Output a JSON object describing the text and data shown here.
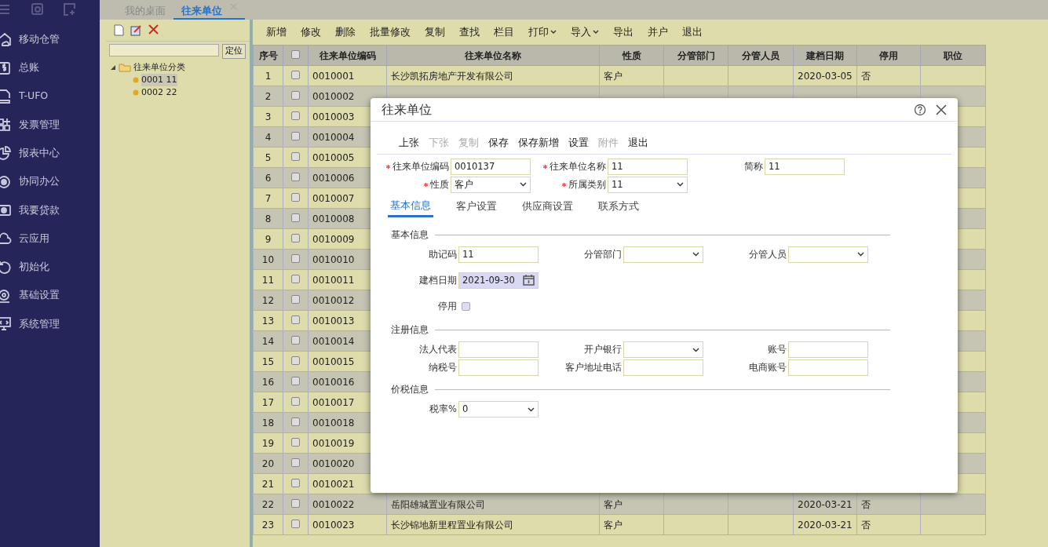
{
  "sidebar": {
    "items": [
      {
        "label": "移动仓管"
      },
      {
        "label": "总账"
      },
      {
        "label": "T-UFO"
      },
      {
        "label": "发票管理"
      },
      {
        "label": "报表中心"
      },
      {
        "label": "协同办公"
      },
      {
        "label": "我要贷款"
      },
      {
        "label": "云应用"
      },
      {
        "label": "初始化"
      },
      {
        "label": "基础设置"
      },
      {
        "label": "系统管理"
      }
    ]
  },
  "tabs": [
    {
      "label": "我的桌面",
      "selected": false,
      "closable": false
    },
    {
      "label": "往来单位",
      "selected": true,
      "closable": true
    }
  ],
  "tree_panel": {
    "search_button": "定位",
    "tree": [
      {
        "label": "往来单位分类",
        "expanded": true,
        "selected": false,
        "children": [
          {
            "label": "0001 11",
            "selected": true
          },
          {
            "label": "0002 22",
            "selected": false
          }
        ]
      }
    ]
  },
  "toolbar": [
    {
      "label": "新增",
      "dropdown": false
    },
    {
      "label": "修改",
      "dropdown": false
    },
    {
      "label": "删除",
      "dropdown": false
    },
    {
      "label": "批量修改",
      "dropdown": false
    },
    {
      "label": "复制",
      "dropdown": false
    },
    {
      "label": "查找",
      "dropdown": false
    },
    {
      "label": "栏目",
      "dropdown": false
    },
    {
      "label": "打印",
      "dropdown": true
    },
    {
      "label": "导入",
      "dropdown": true
    },
    {
      "label": "导出",
      "dropdown": false
    },
    {
      "label": "并户",
      "dropdown": false
    },
    {
      "label": "退出",
      "dropdown": false
    }
  ],
  "table": {
    "columns": [
      "序号",
      "",
      "往来单位编码",
      "往来单位名称",
      "性质",
      "分管部门",
      "分管人员",
      "建档日期",
      "停用",
      "职位"
    ],
    "header_checked": false,
    "rows": [
      {
        "seq": "1",
        "checked": false,
        "code": "0010001",
        "name": "长沙凯拓房地产开发有限公司",
        "nature": "客户",
        "date": "2020-03-05",
        "disabled": "否"
      },
      {
        "seq": "2",
        "checked": false,
        "code": "0010002"
      },
      {
        "seq": "3",
        "checked": false,
        "code": "0010003"
      },
      {
        "seq": "4",
        "checked": false,
        "code": "0010004"
      },
      {
        "seq": "5",
        "checked": false,
        "code": "0010005"
      },
      {
        "seq": "6",
        "checked": false,
        "code": "0010006"
      },
      {
        "seq": "7",
        "checked": false,
        "code": "0010007"
      },
      {
        "seq": "8",
        "checked": false,
        "code": "0010008"
      },
      {
        "seq": "9",
        "checked": false,
        "code": "0010009"
      },
      {
        "seq": "10",
        "checked": false,
        "code": "0010010"
      },
      {
        "seq": "11",
        "checked": false,
        "code": "0010011"
      },
      {
        "seq": "12",
        "checked": false,
        "code": "0010012"
      },
      {
        "seq": "13",
        "checked": false,
        "code": "0010013"
      },
      {
        "seq": "14",
        "checked": false,
        "code": "0010014"
      },
      {
        "seq": "15",
        "checked": false,
        "code": "0010015"
      },
      {
        "seq": "16",
        "checked": false,
        "code": "0010016"
      },
      {
        "seq": "17",
        "checked": false,
        "code": "0010017"
      },
      {
        "seq": "18",
        "checked": false,
        "code": "0010018"
      },
      {
        "seq": "19",
        "checked": false,
        "code": "0010019"
      },
      {
        "seq": "20",
        "checked": false,
        "code": "0010020"
      },
      {
        "seq": "21",
        "checked": false,
        "code": "0010021"
      },
      {
        "seq": "22",
        "checked": false,
        "code": "0010022",
        "name": "岳阳雄城置业有限公司",
        "nature": "客户",
        "date": "2020-03-21",
        "disabled": "否"
      },
      {
        "seq": "23",
        "checked": false,
        "code": "0010023",
        "name": "长沙锦地新里程置业有限公司",
        "nature": "客户",
        "date": "2020-03-21",
        "disabled": "否"
      }
    ]
  },
  "dialog": {
    "title": "往来单位",
    "toolbar": [
      {
        "label": "上张",
        "disabled": false
      },
      {
        "label": "下张",
        "disabled": true
      },
      {
        "label": "复制",
        "disabled": true
      },
      {
        "label": "保存",
        "disabled": false
      },
      {
        "label": "保存新增",
        "disabled": false
      },
      {
        "label": "设置",
        "disabled": false
      },
      {
        "label": "附件",
        "disabled": true
      },
      {
        "label": "退出",
        "disabled": false
      }
    ],
    "header_rows": [
      [
        {
          "label": "往来单位编码",
          "required": true,
          "kind": "text",
          "value": "0010137"
        },
        {
          "label": "往来单位名称",
          "required": true,
          "kind": "text",
          "value": "11"
        },
        {
          "label": "简称",
          "required": false,
          "kind": "text",
          "value": "11"
        }
      ],
      [
        {
          "label": "性质",
          "required": true,
          "kind": "select",
          "value": "客户"
        },
        {
          "label": "所属类别",
          "required": true,
          "kind": "select",
          "value": "11"
        }
      ]
    ],
    "tabs": [
      {
        "label": "基本信息",
        "selected": true
      },
      {
        "label": "客户设置",
        "selected": false
      },
      {
        "label": "供应商设置",
        "selected": false
      },
      {
        "label": "联系方式",
        "selected": false
      }
    ],
    "sections": [
      {
        "title": "基本信息",
        "rows": [
          [
            {
              "label": "助记码",
              "kind": "text",
              "value": "11"
            },
            {
              "label": "分管部门",
              "kind": "select"
            },
            {
              "label": "分管人员",
              "kind": "select"
            }
          ],
          [
            {
              "label": "建档日期",
              "kind": "date",
              "value": "2021-09-30"
            }
          ],
          [
            {
              "label": "停用",
              "kind": "checkbox",
              "checked": false
            }
          ]
        ]
      },
      {
        "title": "注册信息",
        "rows": [
          [
            {
              "label": "法人代表",
              "kind": "text"
            },
            {
              "label": "开户银行",
              "kind": "select"
            },
            {
              "label": "账号",
              "kind": "text"
            }
          ],
          [
            {
              "label": "纳税号",
              "kind": "text"
            },
            {
              "label": "客户地址电话",
              "kind": "text"
            },
            {
              "label": "电商账号",
              "kind": "text"
            }
          ]
        ]
      },
      {
        "title": "价税信息",
        "rows": [
          [
            {
              "label": "税率%",
              "kind": "select",
              "value": "0"
            }
          ]
        ]
      }
    ]
  }
}
